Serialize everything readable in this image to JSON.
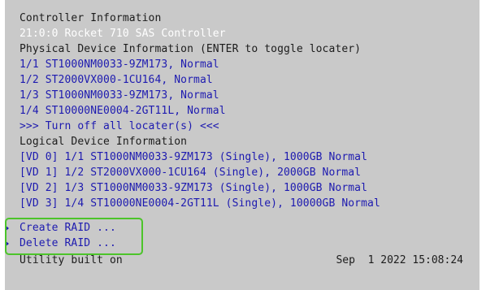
{
  "controller": {
    "heading": "Controller Information",
    "name": "21:0:0 Rocket 710 SAS Controller"
  },
  "physical": {
    "heading": "Physical Device Information (ENTER to toggle locater)",
    "devices": [
      "1/1 ST1000NM0033-9ZM173, Normal",
      "1/2 ST2000VX000-1CU164, Normal",
      "1/3 ST1000NM0033-9ZM173, Normal",
      "1/4 ST10000NE0004-2GT11L, Normal"
    ],
    "turn_off_all": ">>> Turn off all locater(s) <<<"
  },
  "logical": {
    "heading": "Logical Device Information",
    "devices": [
      "[VD 0] 1/1 ST1000NM0033-9ZM173 (Single), 1000GB Normal",
      "[VD 1] 1/2 ST2000VX000-1CU164 (Single), 2000GB Normal",
      "[VD 2] 1/3 ST1000NM0033-9ZM173 (Single), 1000GB Normal",
      "[VD 3] 1/4 ST10000NE0004-2GT11L (Single), 10000GB Normal"
    ]
  },
  "actions": {
    "create_raid": "Create RAID ...",
    "delete_raid": "Delete RAID ..."
  },
  "footer": {
    "utility_built": "Utility built on",
    "build_date": "Sep  1 2022 15:08:24"
  },
  "colors": {
    "background": "#c9c9c9",
    "text_default": "#1c1c1c",
    "text_selected": "#ffffff",
    "text_item": "#1d1ab0",
    "highlight_box": "#4cc42a"
  }
}
